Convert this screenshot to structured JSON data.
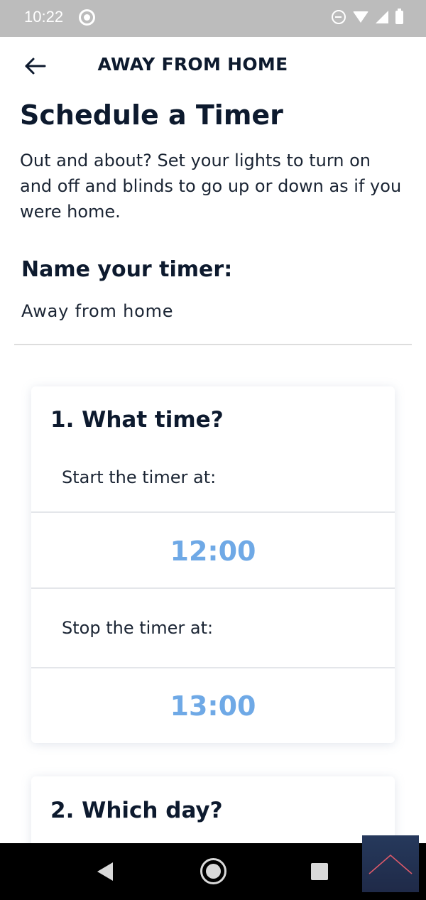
{
  "status_bar": {
    "time": "10:22",
    "icons": [
      "notification-dot-icon",
      "do-not-disturb-icon",
      "wifi-icon",
      "signal-icon",
      "battery-icon"
    ]
  },
  "header": {
    "back_icon": "arrow-left-icon",
    "title": "AWAY FROM HOME"
  },
  "intro": {
    "title": "Schedule a Timer",
    "description": "Out and about? Set your lights to turn on and off and blinds to go up or down as if you were home."
  },
  "timer_name": {
    "label": "Name your timer:",
    "value": "Away from home"
  },
  "time_card": {
    "title": "1. What time?",
    "start_label": "Start the timer at:",
    "start_time": "12:00",
    "stop_label": "Stop the timer at:",
    "stop_time": "13:00"
  },
  "day_card": {
    "title": "2. Which day?"
  },
  "colors": {
    "accent_time": "#6fa9e6",
    "text_dark": "#0d1a2e",
    "status_bar": "#bcbcbc",
    "scroll_button": "#26395c",
    "scroll_chevron": "#e05a6a"
  },
  "nav_bar": {
    "icons": [
      "nav-back-icon",
      "nav-home-icon",
      "nav-recent-icon"
    ]
  },
  "scroll_top_icon": "chevron-up-icon"
}
